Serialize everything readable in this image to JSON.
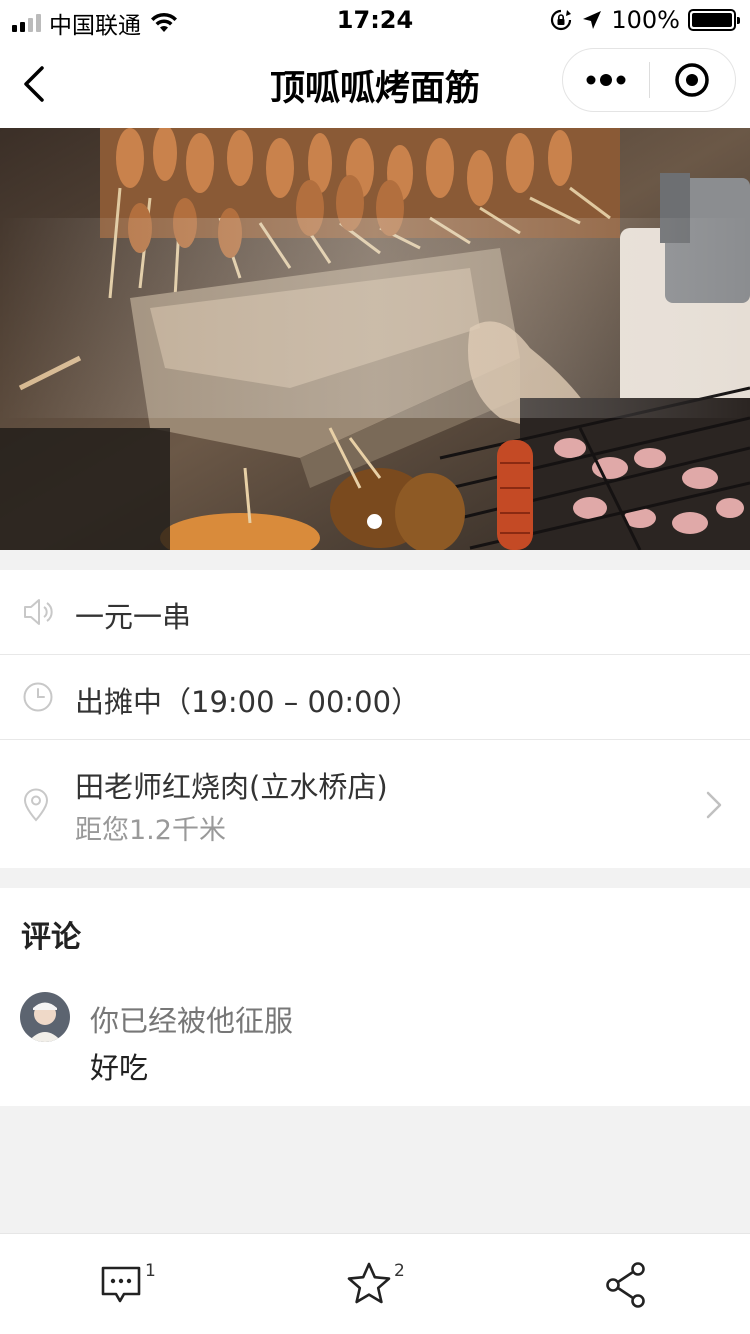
{
  "status_bar": {
    "carrier": "中国联通",
    "time": "17:24",
    "battery": "100%",
    "battery_level": 1.0
  },
  "nav": {
    "title": "顶呱呱烤面筋"
  },
  "banner": {
    "slide_count": 1,
    "active_slide": 1
  },
  "info": {
    "notice": "一元一串",
    "hours": "出摊中（19:00 – 00:00）",
    "location_name": "田老师红烧肉(立水桥店)",
    "distance": "距您1.2千米"
  },
  "comments": {
    "title": "评论",
    "items": [
      {
        "user": "你已经被他征服",
        "text": "好吃"
      }
    ]
  },
  "actions": {
    "comment_count": "1",
    "favorite_count": "2"
  },
  "colors": {
    "icon_gray": "#c8c8c8",
    "text_primary": "#333333",
    "text_secondary": "#999999",
    "background": "#f2f2f2"
  }
}
